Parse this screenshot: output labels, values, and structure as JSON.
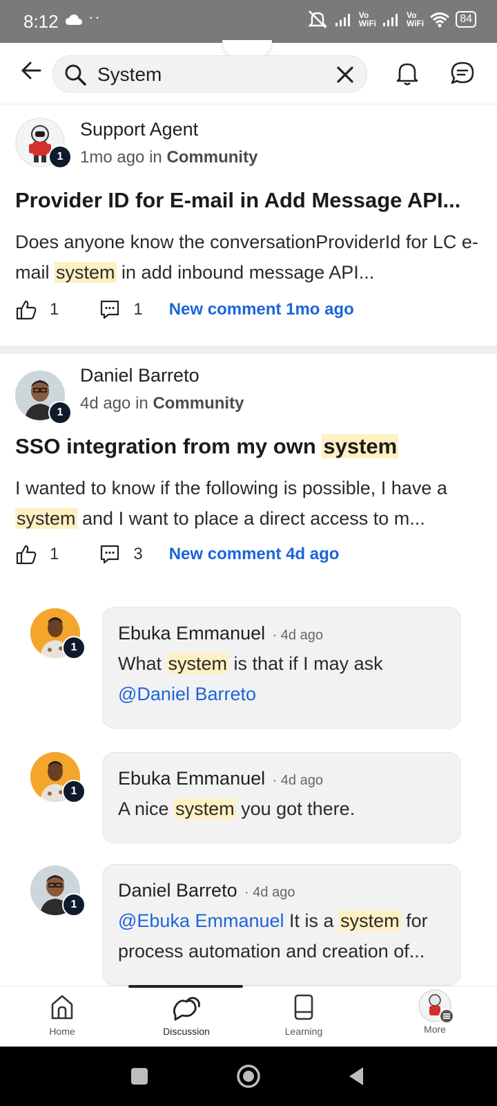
{
  "status_bar": {
    "time": "8:12",
    "dots": "··",
    "vo_top": "Vo",
    "vo_bottom": "WiFi",
    "battery": "84"
  },
  "search": {
    "query": "System"
  },
  "posts": [
    {
      "author": "Support Agent",
      "badge": "1",
      "time": "1mo ago",
      "in": "in",
      "community": "Community",
      "title": "Provider ID for E-mail in Add Message API...",
      "excerpt_before": "Does anyone know the conversationProviderId for LC e-mail ",
      "excerpt_highlight": "system",
      "excerpt_after": " in add inbound message API...",
      "likes": "1",
      "comments": "1",
      "new_comment": "New comment 1mo ago"
    },
    {
      "author": "Daniel Barreto",
      "badge": "1",
      "time": "4d ago",
      "in": "in",
      "community": "Community",
      "title_before": "SSO integration from my own ",
      "title_highlight": "system",
      "excerpt_before": "I wanted to know if the following is possible, I have a ",
      "excerpt_highlight": "system",
      "excerpt_after": " and I want to place a direct access to m...",
      "likes": "1",
      "comments": "3",
      "new_comment": "New comment 4d ago"
    }
  ],
  "comments": [
    {
      "author": "Ebuka Emmanuel",
      "time": "4d ago",
      "badge": "1",
      "text_before": "What ",
      "text_highlight": "system",
      "text_after": " is that if I may ask",
      "mention_after": "@Daniel Barreto"
    },
    {
      "author": "Ebuka Emmanuel",
      "time": "4d ago",
      "badge": "1",
      "text_before": "A nice ",
      "text_highlight": "system",
      "text_after": " you got there."
    },
    {
      "author": "Daniel Barreto",
      "time": "4d ago",
      "badge": "1",
      "mention_before": "@Ebuka Emmanuel",
      "text_before": " It is a ",
      "text_highlight": "system",
      "text_after": " for process automation and creation of..."
    }
  ],
  "bottom_nav": {
    "items": [
      {
        "label": "Home",
        "icon": "home-icon"
      },
      {
        "label": "Discussion",
        "icon": "discussion-icon"
      },
      {
        "label": "Learning",
        "icon": "learning-icon"
      },
      {
        "label": "More",
        "icon": "avatar-more"
      }
    ],
    "active": "Discussion"
  },
  "colors": {
    "accent": "#1d64d8",
    "highlight": "#fdf0c2",
    "badge": "#0f1b2d"
  }
}
